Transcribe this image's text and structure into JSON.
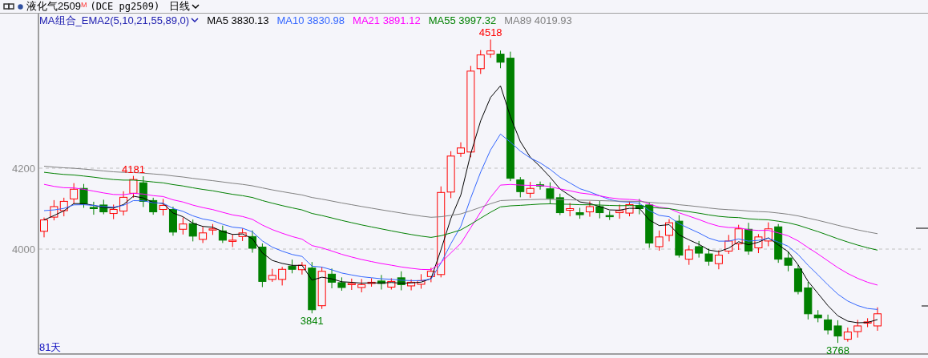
{
  "header": {
    "title": "液化气2509",
    "title_mark": "M",
    "symbol": "(DCE pg2509)",
    "period": "日线"
  },
  "indicator": {
    "name": "MA组合_EMA2(5,10,21,55,89,0)",
    "readings": [
      {
        "label": "MA5 3830.13",
        "color": "#000000"
      },
      {
        "label": "MA10 3830.98",
        "color": "#3366ff"
      },
      {
        "label": "MA21 3891.12",
        "color": "#ff00ff"
      },
      {
        "label": "MA55 3997.32",
        "color": "#008000"
      },
      {
        "label": "MA89 4019.93",
        "color": "#808080"
      }
    ]
  },
  "y_axis": {
    "labels": [
      "4200",
      "4000"
    ]
  },
  "price_marks": [
    {
      "text": "4181",
      "color": "#ff0000"
    },
    {
      "text": "4518",
      "color": "#ff0000"
    },
    {
      "text": "3841",
      "color": "#008000"
    },
    {
      "text": "3768",
      "color": "#008000"
    }
  ],
  "footer": {
    "days": "81天"
  }
}
